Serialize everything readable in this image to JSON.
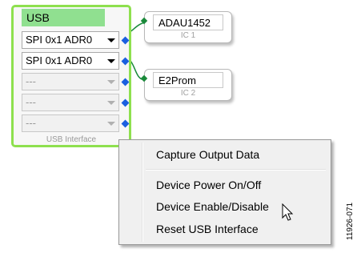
{
  "usb_block": {
    "title": "USB",
    "ports": [
      {
        "label": "SPI 0x1 ADR0",
        "enabled": true
      },
      {
        "label": "SPI 0x1 ADR0",
        "enabled": true
      },
      {
        "label": "---",
        "enabled": false
      },
      {
        "label": "---",
        "enabled": false
      },
      {
        "label": "---",
        "enabled": false
      }
    ],
    "footer": "USB Interface",
    "border_color": "#8ee04e",
    "title_color": "#90e090"
  },
  "ic_blocks": [
    {
      "name": "ADAU1452",
      "sub": "IC 1"
    },
    {
      "name": "E2Prom",
      "sub": "IC 2"
    }
  ],
  "context_menu": {
    "items": [
      "Capture Output Data",
      "Device Power On/Off",
      "Device Enable/Disable",
      "Reset USB Interface"
    ]
  },
  "figure_id": "11926-071",
  "colors": {
    "port_blue": "#1a5fe0",
    "wire_green": "#1a8a3a"
  }
}
